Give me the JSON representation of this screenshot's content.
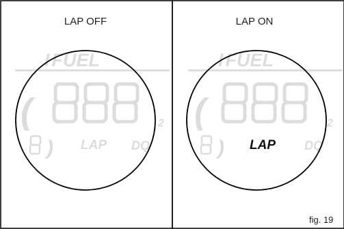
{
  "panels": [
    {
      "caption": "LAP OFF",
      "indicator_text": "LAP",
      "indicator_active": false
    },
    {
      "caption": "LAP ON",
      "indicator_text": "LAP",
      "indicator_active": true
    }
  ],
  "lcd": {
    "fuel_label": "FUEL",
    "fuel_prefix": "I",
    "digits": "888",
    "dq_label": "DQ"
  },
  "colors": {
    "ghost_segment": "#dcdcdc",
    "active_segment": "#111111",
    "outline": "#000000"
  },
  "figure_label": "fig. 19"
}
